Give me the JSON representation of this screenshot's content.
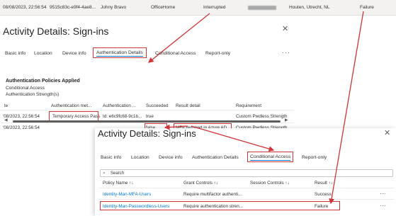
{
  "log_row": {
    "date": "08/08/2023, 22:56:54",
    "request_id": "9515c83c-e9f4-4ae8...",
    "user": "Johny Bravo",
    "application": "OfficeHome",
    "status": "Interrupted",
    "location": "Houten, Utrecht, NL",
    "result": "Failure"
  },
  "panel1": {
    "title": "Activity Details: Sign-ins",
    "tabs": [
      "Basic info",
      "Location",
      "Device info",
      "Authentication Details",
      "Conditional Access",
      "Report-only"
    ],
    "more": "···",
    "section_title": "Authentication Policies Applied",
    "applied_policies": [
      "Conditional Access",
      "Authentication Strength(s)"
    ],
    "columns": [
      "te",
      "Authentication met...",
      "Authentication ...",
      "Succeeded",
      "Result detail",
      "Requirement"
    ],
    "rows": [
      {
        "date": "'08/2023, 22:56:54",
        "method": "Temporary Access Pass",
        "detail": "Id: e6c9fc68-9c1b...",
        "succeeded": "true",
        "result": "",
        "requirement": "Custom Pwdless Strength"
      },
      {
        "date": "'08/2023, 22:56:54",
        "method": "",
        "detail": "",
        "succeeded": "false",
        "result": "MFA required in Azure AD",
        "requirement": "Custom Pwdless Strength"
      }
    ]
  },
  "panel2": {
    "title": "Activity Details: Sign-ins",
    "tabs": [
      "Basic info",
      "Location",
      "Device info",
      "Authentication Details",
      "Conditional Access",
      "Report-only"
    ],
    "search_placeholder": "Search",
    "columns": [
      "Policy Name ↑↓",
      "Grant Controls ↑↓",
      "Session Controls ↑↓",
      "Result ↑↓"
    ],
    "rows": [
      {
        "policy": "Identity-Man-MFA-Users",
        "grant": "Require multifactor authenti...",
        "session": "",
        "result": "Success"
      },
      {
        "policy": "Identity-Man-Passwordless-Users",
        "grant": "Require authentication stren...",
        "session": "",
        "result": "Failure"
      }
    ],
    "more": "···"
  },
  "colors": {
    "highlight": "#d13438",
    "link": "#0078d4",
    "active_tab_underline": "#0078d4"
  }
}
